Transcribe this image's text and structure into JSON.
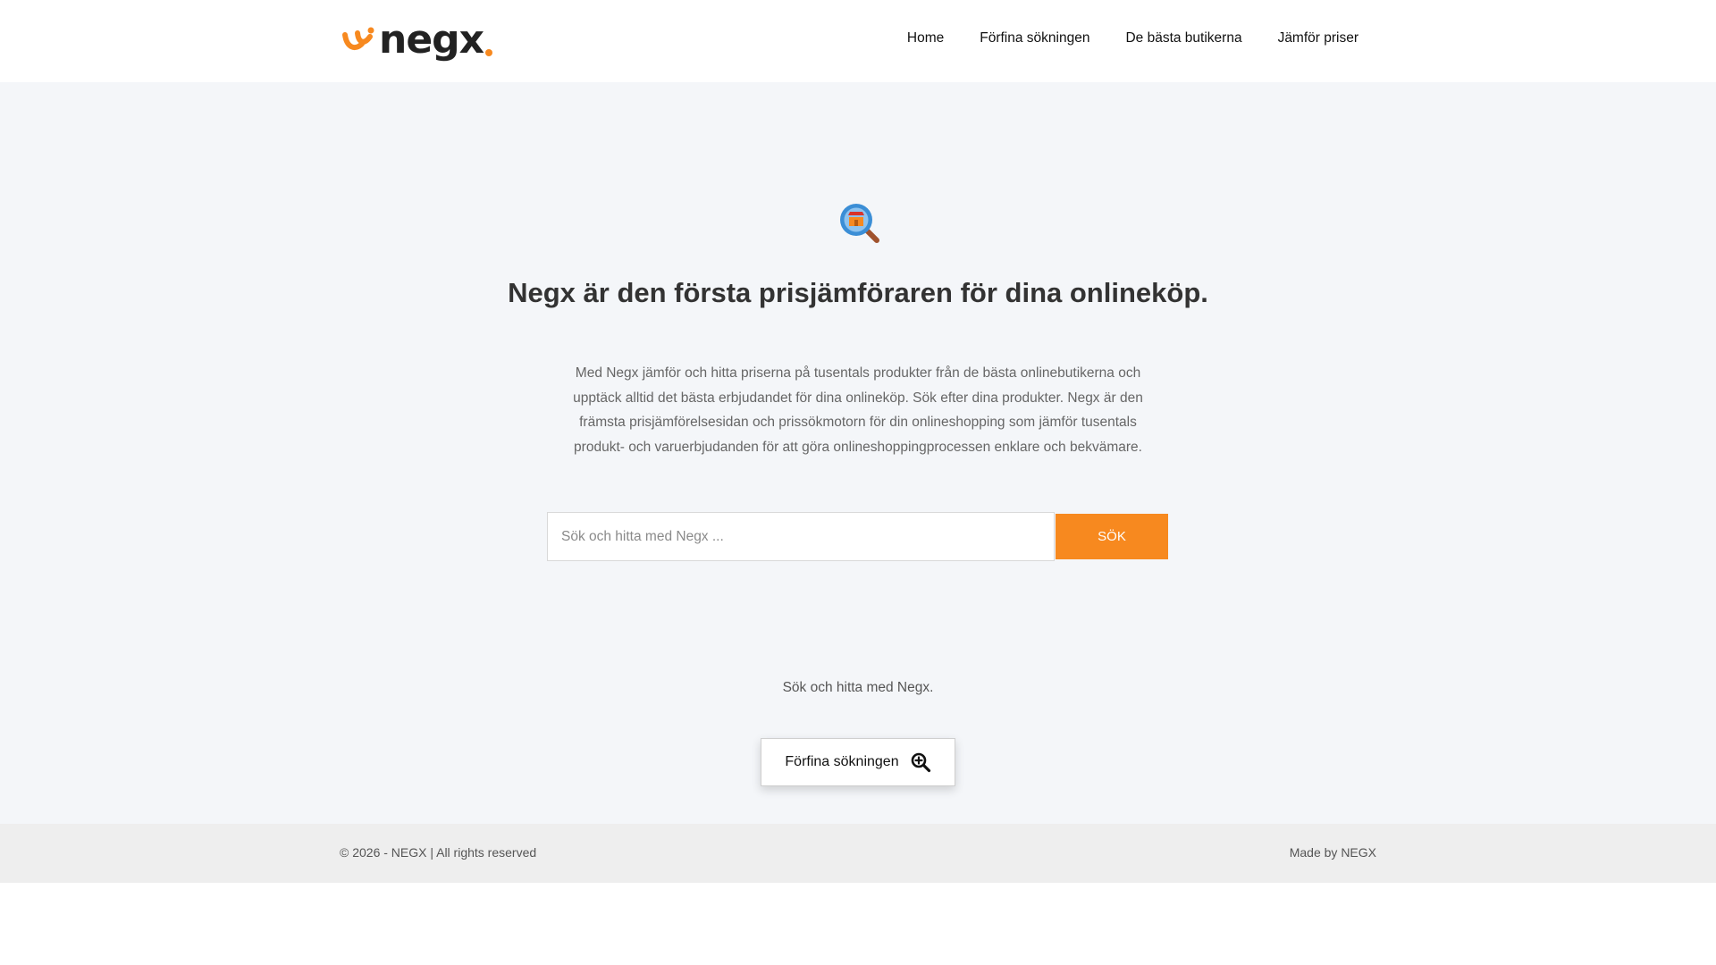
{
  "header": {
    "logo_text": "negx",
    "nav": [
      {
        "label": "Home"
      },
      {
        "label": "Förfina sökningen"
      },
      {
        "label": "De bästa butikerna"
      },
      {
        "label": "Jämför priser"
      }
    ]
  },
  "hero": {
    "icon": "magnifier-shop-icon",
    "title": "Negx är den första prisjämföraren för dina onlineköp.",
    "description": "Med Negx jämför och hitta priserna på tusentals produkter från de bästa onlinebutikerna och upptäck alltid det bästa erbjudandet för dina onlineköp. Sök efter dina produkter. Negx är den främsta prisjämförelsesidan och prissökmotorn för din onlineshopping som jämför tusentals produkt- och varuerbjudanden för att göra onlineshoppingprocessen enklare och bekvämare."
  },
  "search": {
    "placeholder": "Sök och hitta med Negx ...",
    "value": "",
    "button_label": "SÖK",
    "hint": "Sök och hitta med Negx."
  },
  "refine": {
    "label": "Förfina sökningen",
    "icon": "zoom-in-icon"
  },
  "footer": {
    "copyright": "© 2026 - NEGX | All rights reserved",
    "made_by": "Made by NEGX"
  },
  "colors": {
    "accent": "#f7891f",
    "page_bg": "#f4f6f9",
    "footer_bg": "#eeeeee"
  }
}
